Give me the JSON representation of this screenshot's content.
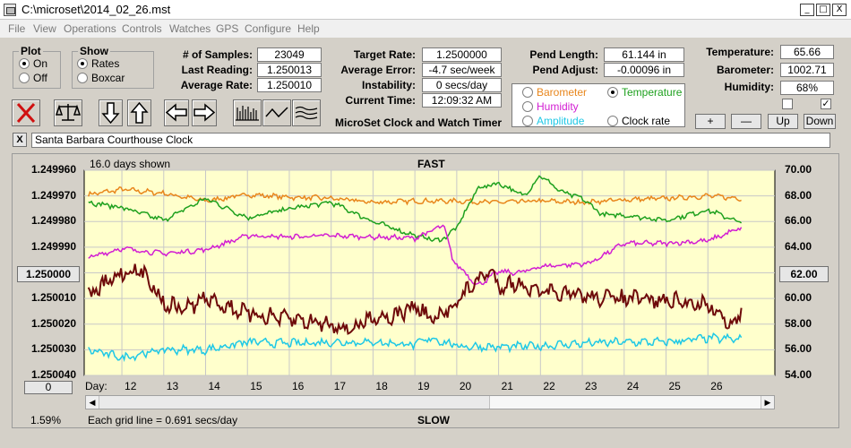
{
  "window": {
    "title": "C:\\microset\\2014_02_26.mst",
    "min": "_",
    "max": "□",
    "close": "X"
  },
  "menu": [
    "File",
    "View",
    "Operations",
    "Controls",
    "Watches",
    "GPS",
    "Configure",
    "Help"
  ],
  "plot_group": {
    "title": "Plot",
    "options": [
      "On",
      "Off"
    ],
    "selected": 0
  },
  "show_group": {
    "title": "Show",
    "options": [
      "Rates",
      "Boxcar"
    ],
    "selected": 0
  },
  "stats": [
    {
      "label": "# of Samples:",
      "value": "23049"
    },
    {
      "label": "Last Reading:",
      "value": "1.250013"
    },
    {
      "label": "Average Rate:",
      "value": "1.250010"
    }
  ],
  "rates": [
    {
      "label": "Target Rate:",
      "value": "1.2500000"
    },
    {
      "label": "Average Error:",
      "value": "-4.7 sec/week"
    },
    {
      "label": "Instability:",
      "value": "0 secs/day"
    },
    {
      "label": "Current Time:",
      "value": "12:09:32 AM"
    }
  ],
  "pend": [
    {
      "label": "Pend Length:",
      "value": "61.144 in"
    },
    {
      "label": "Pend Adjust:",
      "value": "-0.00096 in"
    }
  ],
  "env": [
    {
      "label": "Temperature:",
      "value": "65.66"
    },
    {
      "label": "Barometer:",
      "value": "1002.71"
    },
    {
      "label": "Humidity:",
      "value": "68%"
    }
  ],
  "env_checks": [
    false,
    true
  ],
  "overlay": {
    "options": [
      {
        "label": "Barometer",
        "color": "#e8861c",
        "selected": false
      },
      {
        "label": "Temperature",
        "color": "#1ea01e",
        "selected": true
      },
      {
        "label": "Humidity",
        "color": "#d21ed2",
        "selected": false
      },
      {
        "label": "Amplitude",
        "color": "#1ec8e6",
        "selected": false
      },
      {
        "label": "Clock rate",
        "color": "#000000",
        "selected": false
      }
    ]
  },
  "app_label": "MicroSet Clock and Watch Timer",
  "scale_buttons": [
    "+",
    "—",
    "Up",
    "Down"
  ],
  "clock_name": "Santa Barbara Courthouse Clock",
  "clock_close": "X",
  "graph": {
    "days_shown": "16.0 days shown",
    "top_label": "FAST",
    "bottom_label": "SLOW",
    "grid_note": "Each grid line = 0.691 secs/day",
    "percent": "1.59%",
    "left_button": "1.250000",
    "right_button": "62.00",
    "bottom_button": "0",
    "day_prefix": "Day:"
  },
  "chart_data": {
    "type": "line",
    "y_ticks": [
      "1.249960",
      "1.249970",
      "1.249980",
      "1.249990",
      "1.250000",
      "1.250010",
      "1.250020",
      "1.250030",
      "1.250040"
    ],
    "y2_ticks": [
      "70.00",
      "68.00",
      "66.00",
      "64.00",
      "62.00",
      "60.00",
      "58.00",
      "56.00",
      "54.00"
    ],
    "ylim": [
      1.24996,
      1.25004
    ],
    "y_inverted": true,
    "y2lim": [
      54,
      70
    ],
    "x_ticks": [
      "12",
      "13",
      "14",
      "15",
      "16",
      "17",
      "18",
      "19",
      "20",
      "21",
      "22",
      "23",
      "24",
      "25",
      "26"
    ],
    "xlim": [
      11.1,
      27.6
    ],
    "series": [
      {
        "color": "#e8861c",
        "axis": "y2",
        "x": [
          11.2,
          12,
          13,
          14,
          15,
          16,
          17,
          18,
          19,
          20,
          21,
          22,
          23,
          24,
          25,
          26,
          26.8
        ],
        "values": [
          68.1,
          68.5,
          68.2,
          67.6,
          68.1,
          67.9,
          67.8,
          67.5,
          67.6,
          67.6,
          67.5,
          67.6,
          67.5,
          67.7,
          67.8,
          68.0,
          67.8
        ]
      },
      {
        "color": "#1ea01e",
        "axis": "y2",
        "x": [
          11.2,
          12,
          13,
          14,
          15,
          16,
          17,
          18,
          19,
          19.6,
          20,
          20.5,
          21,
          21.6,
          22,
          22.5,
          23,
          23.5,
          24,
          25,
          26,
          26.8
        ],
        "values": [
          67.5,
          67.1,
          66.1,
          67.8,
          66.3,
          67.0,
          67.5,
          66.0,
          64.9,
          64.5,
          65.5,
          68.6,
          69.0,
          68.0,
          69.6,
          68.3,
          67.8,
          66.5,
          66.5,
          66.1,
          66.9,
          65.9
        ]
      },
      {
        "color": "#d21ed2",
        "axis": "y2",
        "x": [
          11.2,
          12,
          13,
          14,
          15,
          16,
          17,
          18,
          19,
          19.7,
          19.9,
          20.5,
          21,
          21.5,
          22,
          23,
          23.2,
          24,
          25,
          26,
          26.8
        ],
        "values": [
          63.2,
          63.9,
          63.5,
          63.8,
          64.9,
          64.8,
          64.9,
          64.8,
          64.7,
          65.7,
          63.0,
          61.0,
          62.1,
          62.0,
          62.5,
          62.7,
          62.8,
          64.3,
          64.3,
          64.5,
          65.5
        ]
      },
      {
        "color": "#1ec8e6",
        "axis": "y2",
        "x": [
          11.2,
          12,
          13,
          14,
          15,
          16,
          17,
          18,
          19,
          19.4,
          20,
          21,
          22,
          23,
          24,
          25,
          26,
          26.8
        ],
        "values": [
          56.0,
          55.4,
          56.0,
          56.0,
          56.6,
          56.5,
          56.6,
          56.6,
          56.4,
          56.9,
          56.3,
          56.2,
          56.3,
          56.5,
          56.6,
          56.6,
          56.9,
          56.8
        ],
        "noise": 0.25
      },
      {
        "color": "#6e0a0a",
        "axis": "y",
        "x": [
          11.2,
          12,
          12.3,
          12.6,
          13,
          13.5,
          14,
          15,
          16,
          16.5,
          17,
          17.5,
          18,
          18.5,
          19,
          19.5,
          20,
          20.5,
          20.8,
          21,
          21.5,
          22,
          23,
          24,
          25,
          26,
          26.6,
          26.8
        ],
        "values": [
          1.250009,
          1.25,
          1.249999,
          1.250001,
          1.250012,
          1.250014,
          1.25001,
          1.250016,
          1.250018,
          1.250019,
          1.25002,
          1.250022,
          1.250017,
          1.250017,
          1.250013,
          1.250019,
          1.250011,
          1.250003,
          1.249999,
          1.250005,
          1.250004,
          1.250008,
          1.250009,
          1.25001,
          1.250011,
          1.250012,
          1.250021,
          1.250015
        ],
        "noise": 2.5e-06
      }
    ]
  }
}
